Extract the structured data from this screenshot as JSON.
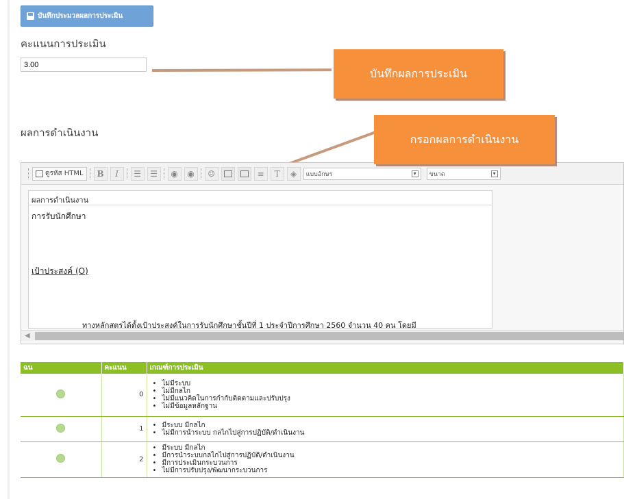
{
  "form": {
    "save_button_label": "บันทึกประมวลผลการประเมิน",
    "score_label": "คะแนนการประเมิน",
    "score_value": "3.00",
    "result_label": "ผลการดำเนินงาน"
  },
  "callouts": {
    "save": "บันทึกผลการประเมิน",
    "result": "กรอกผลการดำเนินงาน"
  },
  "editor": {
    "source_label": "ดูรหัส HTML",
    "font_select": "แบบอักษร",
    "size_select": "ขนาด",
    "content_tag": "ผลการดำเนินงาน",
    "content_line1": "การรับนักศึกษา",
    "content_line2": "เป้าประสงค์ (O)",
    "content_line3": "ทางหลักสูตรได้ตั้งเป้าประสงค์ในการรับนักศึกษาชั้นปีที่ 1 ประจำปีการศึกษา 2560 จำนวน 40 คน โดยมี"
  },
  "table": {
    "headers": [
      "ฉน",
      "คะแนน",
      "เกณฑ์การประเมิน"
    ],
    "rows": [
      {
        "score": "0",
        "criteria": [
          "ไม่มีระบบ",
          "ไม่มีกลไก",
          "ไม่มีแนวคิดในการกำกับติดตามและปรับปรุง",
          "ไม่มีข้อมูลหลักฐาน"
        ]
      },
      {
        "score": "1",
        "criteria": [
          "มีระบบ มีกลไก",
          "ไม่มีการนำระบบ กลไกไปสู่การปฏิบัติ/ดำเนินงาน"
        ]
      },
      {
        "score": "2",
        "criteria": [
          "มีระบบ มีกลไก",
          "มีการนำระบบกลไกไปสู่การปฏิบัติ/ดำเนินงาน",
          "มีการประเมินกระบวนการ",
          "ไม่มีการปรับปรุง/พัฒนากระบวนการ"
        ]
      }
    ]
  },
  "colors": {
    "accent": "#f7903a",
    "table_header": "#8cbf26",
    "button": "#6fa3d8"
  }
}
